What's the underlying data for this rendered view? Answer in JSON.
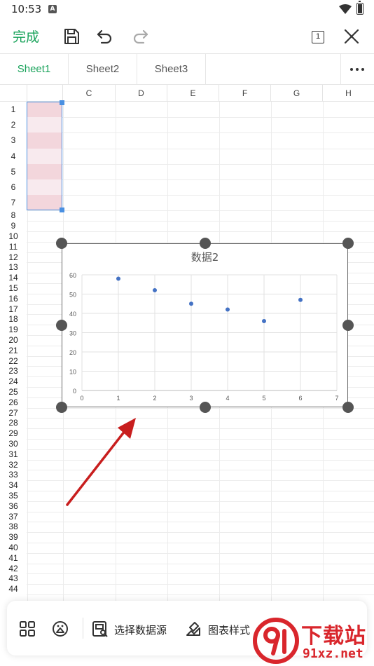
{
  "status_bar": {
    "time": "10:53",
    "notification_letter": "A"
  },
  "toolbar": {
    "done_label": "完成",
    "page_count": "1"
  },
  "tabs": [
    {
      "label": "Sheet1",
      "active": true
    },
    {
      "label": "Sheet2",
      "active": false
    },
    {
      "label": "Sheet3",
      "active": false
    }
  ],
  "columns": [
    "C",
    "D",
    "E",
    "F",
    "G",
    "H"
  ],
  "rows": [
    "1",
    "2",
    "3",
    "4",
    "5",
    "6",
    "7",
    "8",
    "9",
    "10",
    "11",
    "12",
    "13",
    "14",
    "15",
    "16",
    "17",
    "18",
    "19",
    "20",
    "21",
    "22",
    "23",
    "24",
    "25",
    "26",
    "27",
    "28",
    "29",
    "30",
    "31",
    "32",
    "33",
    "34",
    "35",
    "36",
    "37",
    "38",
    "39",
    "40",
    "41",
    "42",
    "43",
    "44"
  ],
  "chart_data": {
    "type": "scatter",
    "title": "数据2",
    "x": [
      1,
      2,
      3,
      4,
      5,
      6
    ],
    "y": [
      58,
      52,
      45,
      42,
      36,
      47
    ],
    "xlim": [
      0,
      7
    ],
    "ylim": [
      0,
      60
    ],
    "x_ticks": [
      0,
      1,
      2,
      3,
      4,
      5,
      6,
      7
    ],
    "y_ticks": [
      0,
      10,
      20,
      30,
      40,
      50,
      60
    ],
    "grid": true,
    "marker_color": "#4472c4"
  },
  "bottom_bar": {
    "select_data_label": "选择数据源",
    "chart_style_label": "图表样式"
  },
  "watermark": {
    "brand": "下载站",
    "url": "91xz.net"
  },
  "colors": {
    "accent": "#1aa35b",
    "selection": "#4a90e2",
    "selected_fill": "#f3d6dc",
    "watermark": "#d9262c"
  }
}
